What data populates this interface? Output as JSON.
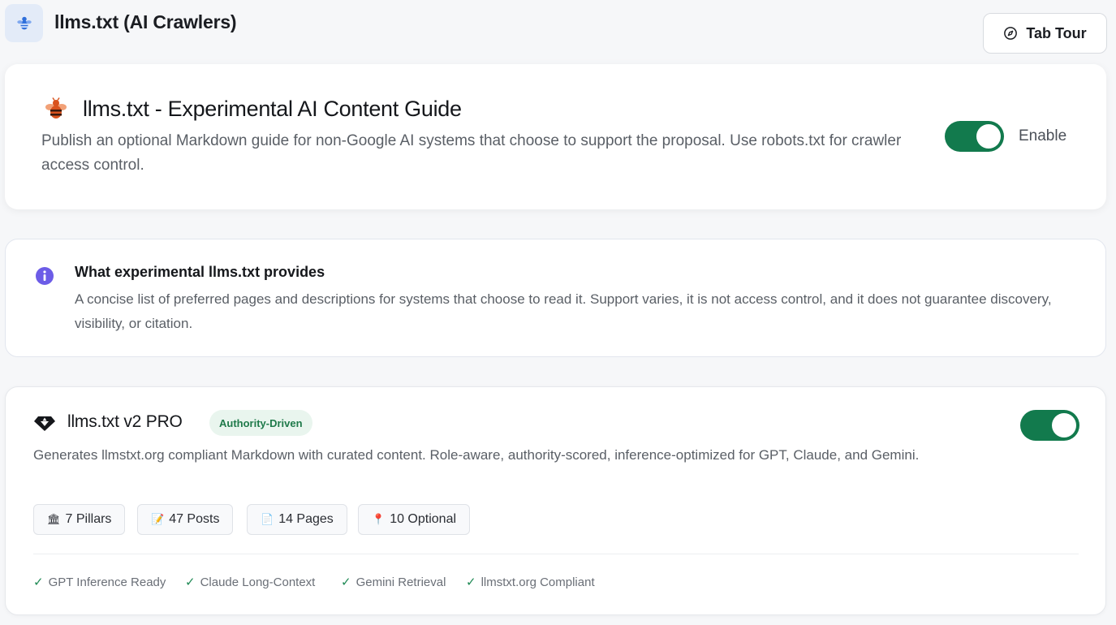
{
  "header": {
    "title": "llms.txt (AI Crawlers)",
    "icon": "bee-icon",
    "tour_button": {
      "label": "Tab Tour",
      "icon": "compass-icon"
    }
  },
  "guide_card": {
    "icon": "bee-icon",
    "title": "llms.txt - Experimental AI Content Guide",
    "description": "Publish an optional Markdown guide for non-Google AI systems that choose to support the proposal. Use robots.txt for crawler access control.",
    "toggle_on": true,
    "toggle_label": "Enable"
  },
  "info_card": {
    "icon": "info-icon",
    "title": "What experimental llms.txt provides",
    "description": "A concise list of preferred pages and descriptions for systems that choose to read it. Support varies, it is not access control, and it does not guarantee discovery, visibility, or citation."
  },
  "pro_card": {
    "icon": "diamond-icon",
    "title": "llms.txt v2 PRO",
    "badge": "Authority-Driven",
    "toggle_on": true,
    "description": "Generates llmstxt.org compliant Markdown with curated content. Role-aware, authority-scored, inference-optimized for GPT, Claude, and Gemini.",
    "stats": [
      {
        "icon": "🏛",
        "label": "7 Pillars"
      },
      {
        "icon": "📝",
        "label": "47 Posts"
      },
      {
        "icon": "📄",
        "label": "14 Pages"
      },
      {
        "icon": "📍",
        "label": "10 Optional"
      }
    ],
    "checks": [
      {
        "mark": "✓",
        "label": "GPT Inference Ready"
      },
      {
        "mark": "✓",
        "label": "Claude Long-Context"
      },
      {
        "mark": "✓",
        "label": "Gemini Retrieval"
      },
      {
        "mark": "✓",
        "label": "llmstxt.org Compliant"
      }
    ]
  },
  "colors": {
    "accent_green": "#127a4d",
    "badge_bg": "#e9f5ee",
    "info_purple": "#6c5ce7",
    "bee_orange": "#d9531e"
  }
}
